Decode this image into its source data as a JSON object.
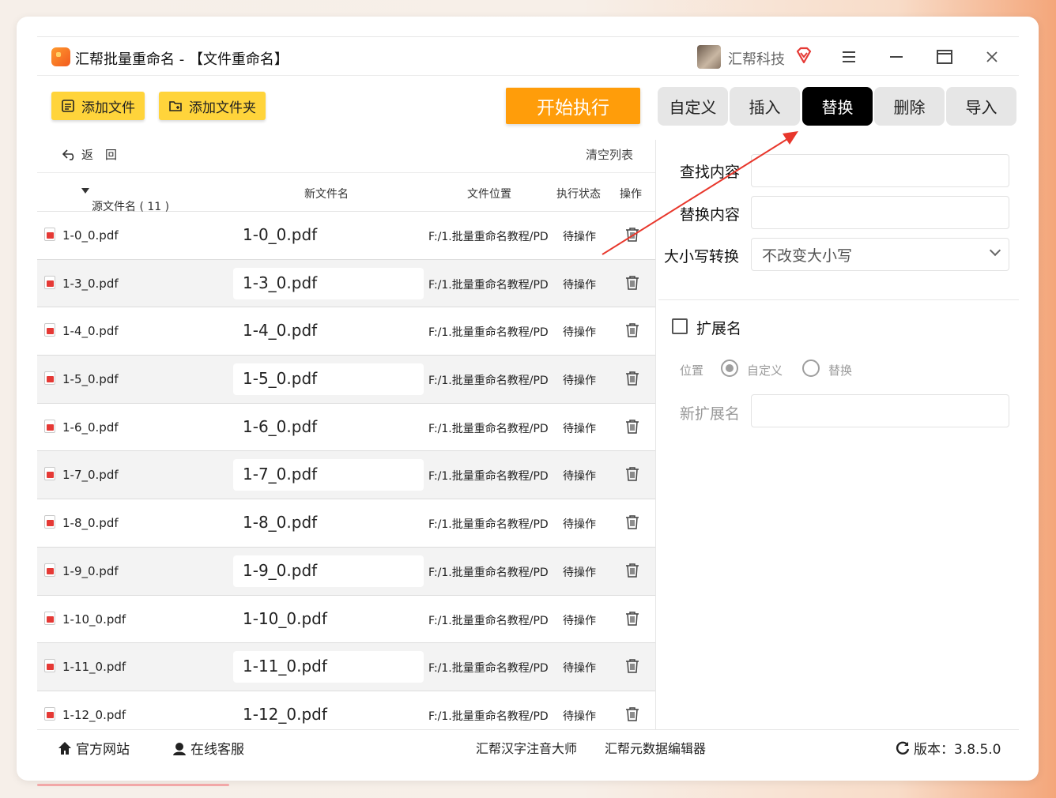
{
  "app": {
    "title": "汇帮批量重命名 - 【文件重命名】",
    "brand": "汇帮科技"
  },
  "toolbar": {
    "add_file": "添加文件",
    "add_folder": "添加文件夹",
    "start": "开始执行"
  },
  "tabs": [
    {
      "label": "自定义",
      "active": false
    },
    {
      "label": "插入",
      "active": false
    },
    {
      "label": "替换",
      "active": true
    },
    {
      "label": "删除",
      "active": false
    },
    {
      "label": "导入",
      "active": false
    }
  ],
  "list": {
    "back": "返　回",
    "clear": "清空列表",
    "headers": {
      "source": "源文件名 ( 11 )",
      "new": "新文件名",
      "location": "文件位置",
      "status": "执行状态",
      "action": "操作"
    },
    "rows": [
      {
        "source": "1-0_0.pdf",
        "new": "1-0_0.pdf",
        "location": "F:/1.批量重命名教程/PD",
        "status": "待操作"
      },
      {
        "source": "1-3_0.pdf",
        "new": "1-3_0.pdf",
        "location": "F:/1.批量重命名教程/PD",
        "status": "待操作"
      },
      {
        "source": "1-4_0.pdf",
        "new": "1-4_0.pdf",
        "location": "F:/1.批量重命名教程/PD",
        "status": "待操作"
      },
      {
        "source": "1-5_0.pdf",
        "new": "1-5_0.pdf",
        "location": "F:/1.批量重命名教程/PD",
        "status": "待操作"
      },
      {
        "source": "1-6_0.pdf",
        "new": "1-6_0.pdf",
        "location": "F:/1.批量重命名教程/PD",
        "status": "待操作"
      },
      {
        "source": "1-7_0.pdf",
        "new": "1-7_0.pdf",
        "location": "F:/1.批量重命名教程/PD",
        "status": "待操作"
      },
      {
        "source": "1-8_0.pdf",
        "new": "1-8_0.pdf",
        "location": "F:/1.批量重命名教程/PD",
        "status": "待操作"
      },
      {
        "source": "1-9_0.pdf",
        "new": "1-9_0.pdf",
        "location": "F:/1.批量重命名教程/PD",
        "status": "待操作"
      },
      {
        "source": "1-10_0.pdf",
        "new": "1-10_0.pdf",
        "location": "F:/1.批量重命名教程/PD",
        "status": "待操作"
      },
      {
        "source": "1-11_0.pdf",
        "new": "1-11_0.pdf",
        "location": "F:/1.批量重命名教程/PD",
        "status": "待操作"
      },
      {
        "source": "1-12_0.pdf",
        "new": "1-12_0.pdf",
        "location": "F:/1.批量重命名教程/PD",
        "status": "待操作"
      }
    ]
  },
  "panel": {
    "find_label": "查找内容",
    "find_value": "",
    "replace_label": "替换内容",
    "replace_value": "",
    "case_label": "大小写转换",
    "case_value": "不改变大小写",
    "ext_label": "扩展名",
    "ext_checked": false,
    "position_label": "位置",
    "opt_custom": "自定义",
    "opt_replace": "替换",
    "new_ext_label": "新扩展名",
    "new_ext_value": ""
  },
  "footer": {
    "website": "官方网站",
    "service": "在线客服",
    "tool1": "汇帮汉字注音大师",
    "tool2": "汇帮元数据编辑器",
    "version": "版本：3.8.5.0"
  },
  "colors": {
    "accent_orange": "#ff9d0a",
    "button_yellow": "#ffd43b",
    "active_tab": "#000000",
    "annotation_arrow": "#e8372c"
  }
}
